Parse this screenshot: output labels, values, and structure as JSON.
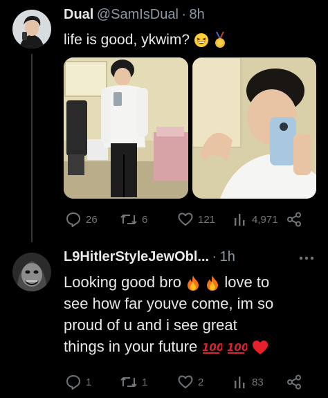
{
  "tweet": {
    "display_name": "Dual",
    "handle": "@SamIsDual",
    "separator": "·",
    "time": "8h",
    "text": "life is good, ykwim?",
    "emojis": [
      "grinning-squinting-face",
      "gold-medal"
    ],
    "actions": {
      "replies": "26",
      "retweets": "6",
      "likes": "121",
      "views": "4,971"
    }
  },
  "reply": {
    "display_name": "L9HitlerStyleJewObl...",
    "separator": "·",
    "time": "1h",
    "lines": [
      "Looking good bro",
      "love to",
      "see how far youve come, im so",
      "proud of u and i see great",
      "things in your future"
    ],
    "emojis": [
      "fire",
      "fire",
      "hundred-points",
      "hundred-points",
      "red-heart"
    ],
    "actions": {
      "replies": "1",
      "retweets": "1",
      "likes": "2",
      "views": "83"
    }
  },
  "icons": [
    "reply-icon",
    "retweet-icon",
    "like-icon",
    "views-icon",
    "share-icon",
    "more-icon"
  ],
  "colors": {
    "background": "#000000",
    "text": "#e7e9ea",
    "muted": "#71767b",
    "thread_line": "#333639"
  }
}
